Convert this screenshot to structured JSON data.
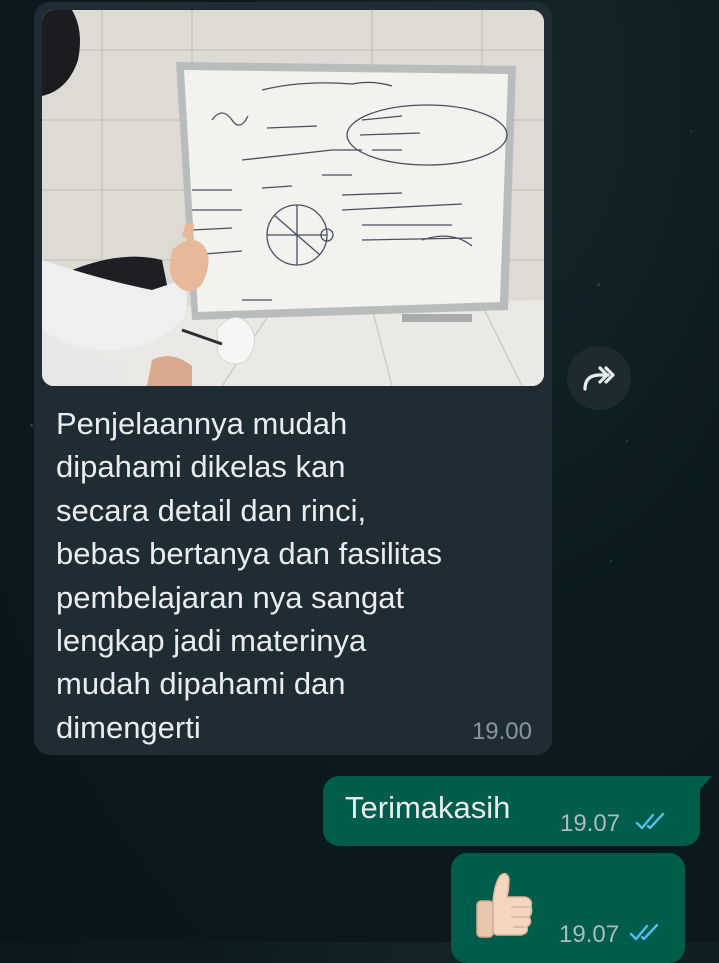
{
  "messages": {
    "incoming": {
      "caption": "Penjelaannya mudah\ndipahami dikelas kan\nsecara detail dan rinci,\nbebas bertanya dan fasilitas\npembelajaran nya sangat\nlengkap jadi materinya\nmudah dipahami dan\ndimengerti",
      "time": "19.00"
    },
    "outgoing_text": {
      "text": "Terimakasih",
      "time": "19.07",
      "status": "read"
    },
    "outgoing_emoji": {
      "emoji": "thumbs-up",
      "time": "19.07",
      "status": "read"
    }
  },
  "icons": {
    "forward": "forward-icon",
    "read_receipt": "double-check-icon"
  },
  "colors": {
    "background": "#0c1a1f",
    "incoming_bubble": "#202c33",
    "outgoing_bubble": "#005c4b",
    "read_tick": "#53bdeb",
    "time_text": "#8696a0"
  }
}
